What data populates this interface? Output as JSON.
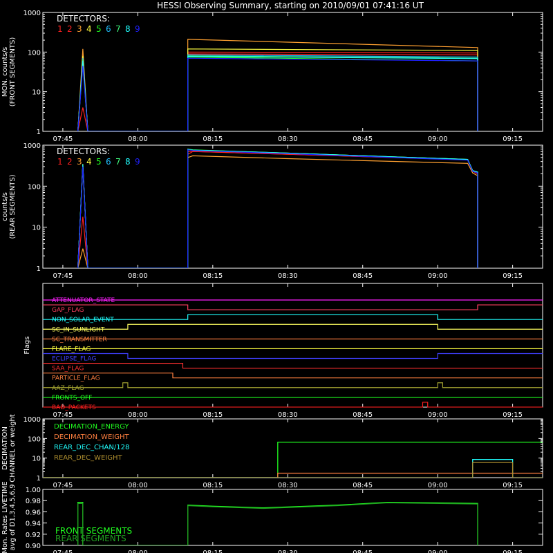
{
  "title": "HESSI Observing Summary, starting on 2010/09/01 07:41:16 UT",
  "time_ticks": [
    "07:45",
    "08:00",
    "08:15",
    "08:30",
    "08:45",
    "09:00",
    "09:15"
  ],
  "time_tick_hours": [
    7.75,
    8.0,
    8.25,
    8.5,
    8.75,
    9.0,
    9.25
  ],
  "colors": {
    "det": [
      "#ff2020",
      "#ff2020",
      "#ffa030",
      "#ffff40",
      "#20ff20",
      "#20c0ff",
      "#40ff80",
      "#20ffff",
      "#2020ff"
    ],
    "front_segments": "#20ff20",
    "rear_segments": "#20a020"
  },
  "chart_data": [
    {
      "id": "front",
      "type": "line",
      "ylabel": [
        "MON. counts/s",
        "(FRONT SEGMENTS)"
      ],
      "y_scale": "log",
      "ylim": [
        1,
        1000
      ],
      "y_ticks": [
        "1",
        "10",
        "100",
        "1000"
      ],
      "xlim": [
        "07:41",
        "09:21"
      ],
      "legend_title": "DETECTORS:",
      "legend": [
        "1",
        "2",
        "3",
        "4",
        "5",
        "6",
        "7",
        "8",
        "9"
      ],
      "series": [
        {
          "name": "1",
          "x": [
            "07:48",
            "07:49",
            "07:50",
            "08:10",
            "08:10",
            "09:08",
            "09:08"
          ],
          "y": [
            1,
            4,
            1,
            1,
            100,
            95,
            1
          ]
        },
        {
          "name": "2",
          "x": [
            "07:48",
            "07:49",
            "07:50",
            "08:10",
            "08:10",
            "09:08",
            "09:08"
          ],
          "y": [
            1,
            60,
            1,
            1,
            90,
            85,
            1
          ]
        },
        {
          "name": "3",
          "x": [
            "07:48",
            "07:49",
            "07:50",
            "08:10",
            "08:10",
            "09:08",
            "09:08"
          ],
          "y": [
            1,
            120,
            1,
            1,
            210,
            130,
            1
          ]
        },
        {
          "name": "4",
          "x": [
            "07:48",
            "07:49",
            "07:50",
            "08:10",
            "08:10",
            "09:08",
            "09:08"
          ],
          "y": [
            1,
            80,
            1,
            1,
            120,
            110,
            1
          ]
        },
        {
          "name": "5",
          "x": [
            "07:48",
            "07:49",
            "07:50",
            "08:10",
            "08:10",
            "09:08",
            "09:08"
          ],
          "y": [
            1,
            50,
            1,
            1,
            75,
            60,
            1
          ]
        },
        {
          "name": "6",
          "x": [
            "07:48",
            "07:49",
            "07:50",
            "08:10",
            "08:10",
            "09:08",
            "09:08"
          ],
          "y": [
            1,
            70,
            1,
            1,
            85,
            75,
            1
          ]
        },
        {
          "name": "7",
          "x": [
            "07:48",
            "07:49",
            "07:50",
            "08:10",
            "08:10",
            "09:08",
            "09:08"
          ],
          "y": [
            1,
            65,
            1,
            1,
            80,
            70,
            1
          ]
        },
        {
          "name": "8",
          "x": [
            "07:48",
            "07:49",
            "07:50",
            "08:10",
            "08:10",
            "09:08",
            "09:08"
          ],
          "y": [
            1,
            60,
            1,
            1,
            78,
            68,
            1
          ]
        },
        {
          "name": "9",
          "x": [
            "07:48",
            "07:49",
            "07:50",
            "08:10",
            "08:10",
            "09:08",
            "09:08"
          ],
          "y": [
            1,
            45,
            1,
            1,
            70,
            60,
            1
          ]
        }
      ]
    },
    {
      "id": "rear",
      "type": "line",
      "ylabel": [
        "counts/s",
        "(REAR SEGMENTS)"
      ],
      "y_scale": "log",
      "ylim": [
        1,
        1000
      ],
      "y_ticks": [
        "1",
        "10",
        "100",
        "1000"
      ],
      "xlim": [
        "07:41",
        "09:21"
      ],
      "legend_title": "DETECTORS:",
      "legend": [
        "1",
        "2",
        "3",
        "4",
        "5",
        "6",
        "7",
        "8",
        "9"
      ],
      "series": [
        {
          "name": "1",
          "x": [
            "07:48",
            "07:49",
            "07:50",
            "08:10",
            "08:10",
            "08:11",
            "08:30",
            "09:06",
            "09:07",
            "09:08",
            "09:08"
          ],
          "y": [
            1,
            18,
            1,
            1,
            600,
            700,
            600,
            440,
            230,
            210,
            1
          ]
        },
        {
          "name": "2",
          "x": [
            "07:48",
            "07:49",
            "07:50",
            "08:10",
            "08:10",
            "08:11",
            "08:30",
            "09:06",
            "09:07",
            "09:08",
            "09:08"
          ],
          "y": [
            1,
            300,
            1,
            1,
            700,
            700,
            600,
            440,
            230,
            200,
            1
          ]
        },
        {
          "name": "3",
          "x": [
            "07:48",
            "07:49",
            "07:50",
            "08:10",
            "08:10",
            "08:11",
            "08:30",
            "09:06",
            "09:07",
            "09:08",
            "09:08"
          ],
          "y": [
            1,
            3,
            1,
            1,
            500,
            550,
            470,
            360,
            210,
            180,
            1
          ]
        },
        {
          "name": "4",
          "x": [
            "07:48",
            "07:49",
            "07:50",
            "08:10",
            "08:10",
            "08:11",
            "08:30",
            "09:06",
            "09:07",
            "09:08",
            "09:08"
          ],
          "y": [
            1,
            350,
            1,
            1,
            800,
            760,
            640,
            450,
            240,
            220,
            1
          ]
        },
        {
          "name": "5",
          "x": [
            "07:48",
            "07:49",
            "07:50",
            "08:10",
            "08:10",
            "08:11",
            "08:30",
            "09:06",
            "09:07",
            "09:08",
            "09:08"
          ],
          "y": [
            1,
            330,
            1,
            1,
            800,
            770,
            640,
            450,
            240,
            220,
            1
          ]
        },
        {
          "name": "6",
          "x": [
            "07:48",
            "07:49",
            "07:50",
            "08:10",
            "08:10",
            "08:11",
            "08:30",
            "09:06",
            "09:07",
            "09:08",
            "09:08"
          ],
          "y": [
            1,
            320,
            1,
            1,
            780,
            750,
            630,
            440,
            235,
            215,
            1
          ]
        },
        {
          "name": "7",
          "x": [
            "07:48",
            "07:49",
            "07:50",
            "08:10",
            "08:10",
            "08:11",
            "08:30",
            "09:06",
            "09:07",
            "09:08",
            "09:08"
          ],
          "y": [
            1,
            330,
            1,
            1,
            780,
            750,
            630,
            440,
            235,
            215,
            1
          ]
        },
        {
          "name": "8",
          "x": [
            "07:48",
            "07:49",
            "07:50",
            "08:10",
            "08:10",
            "08:11",
            "08:30",
            "09:06",
            "09:07",
            "09:08",
            "09:08"
          ],
          "y": [
            1,
            340,
            1,
            1,
            790,
            760,
            640,
            450,
            240,
            220,
            1
          ]
        },
        {
          "name": "9",
          "x": [
            "07:48",
            "07:49",
            "07:50",
            "08:10",
            "08:10",
            "08:11",
            "08:30",
            "09:06",
            "09:07",
            "09:08",
            "09:08"
          ],
          "y": [
            1,
            300,
            1,
            1,
            770,
            740,
            620,
            430,
            230,
            210,
            1
          ]
        }
      ]
    },
    {
      "id": "flags",
      "type": "line",
      "ylabel": [
        "Flags"
      ],
      "xlim": [
        "07:41",
        "09:21"
      ],
      "flags": [
        {
          "name": "ATTENUATOR_STATE",
          "color": "#ff20ff",
          "x": [
            "07:41",
            "09:21"
          ],
          "state": [
            0,
            0
          ]
        },
        {
          "name": "GAP_FLAG",
          "color": "#ff4060",
          "x": [
            "07:41",
            "08:10",
            "09:08",
            "09:21"
          ],
          "state": [
            1,
            0,
            1,
            1
          ]
        },
        {
          "name": "NON_SOLAR_EVENT",
          "color": "#20ffff",
          "x": [
            "07:41",
            "08:10",
            "09:00",
            "09:21"
          ],
          "state": [
            0,
            1,
            0,
            0
          ]
        },
        {
          "name": "SC_IN_SUNLIGHT",
          "color": "#ffff60",
          "x": [
            "07:41",
            "07:58",
            "09:00",
            "09:21"
          ],
          "state": [
            0,
            1,
            0,
            0
          ]
        },
        {
          "name": "SC_TRANSMITTER",
          "color": "#ff8040",
          "x": [
            "07:41",
            "09:21"
          ],
          "state": [
            0,
            0
          ]
        },
        {
          "name": "FLARE_FLAG",
          "color": "#ffff40",
          "x": [
            "07:41",
            "09:21"
          ],
          "state": [
            0,
            0
          ]
        },
        {
          "name": "ECLIPSE_FLAG",
          "color": "#4040ff",
          "x": [
            "07:41",
            "07:58",
            "09:00",
            "09:21"
          ],
          "state": [
            1,
            0,
            1,
            1
          ]
        },
        {
          "name": "SAA_FLAG",
          "color": "#ff3030",
          "x": [
            "07:41",
            "08:09",
            "09:21"
          ],
          "state": [
            1,
            0,
            0
          ]
        },
        {
          "name": "PARTICLE_FLAG",
          "color": "#ff8040",
          "x": [
            "07:41",
            "08:07",
            "09:21"
          ],
          "state": [
            1,
            0,
            0
          ]
        },
        {
          "name": "AAZ_FLAG",
          "color": "#a0a030",
          "x": [
            "07:41",
            "07:57",
            "07:58",
            "09:00",
            "09:01",
            "09:21"
          ],
          "state": [
            0,
            1,
            0,
            1,
            0,
            0
          ]
        },
        {
          "name": "FRONTS_OFF",
          "color": "#20ff20",
          "x": [
            "07:41",
            "09:21"
          ],
          "state": [
            0,
            0
          ]
        },
        {
          "name": "BAD_PACKETS",
          "color": "#ff2020",
          "x": [
            "07:41",
            "08:57",
            "08:58",
            "09:21"
          ],
          "state": [
            0,
            1,
            0,
            0
          ]
        }
      ]
    },
    {
      "id": "decimation",
      "type": "line",
      "ylabel": [
        "DECIMATION",
        "CHANNEL or weight"
      ],
      "y_scale": "log",
      "ylim": [
        1,
        1000
      ],
      "y_ticks": [
        "1",
        "10",
        "100",
        "1000"
      ],
      "xlim": [
        "07:41",
        "09:21"
      ],
      "series": [
        {
          "name": "DECIMATION_ENERGY",
          "color": "#20ff20",
          "x": [
            "07:41",
            "08:28",
            "08:28",
            "09:21"
          ],
          "y": [
            1,
            1,
            65,
            65
          ]
        },
        {
          "name": "DECIMATION_WEIGHT",
          "color": "#ff8040",
          "x": [
            "07:41",
            "08:28",
            "08:28",
            "09:21"
          ],
          "y": [
            1,
            1,
            1.7,
            1.7
          ]
        },
        {
          "name": "REAR_DEC_CHAN/128",
          "color": "#20ffff",
          "x": [
            "07:41",
            "09:07",
            "09:07",
            "09:15",
            "09:15",
            "09:21"
          ],
          "y": [
            1,
            1,
            8.5,
            8.5,
            1,
            1
          ]
        },
        {
          "name": "REAR_DEC_WEIGHT",
          "color": "#b09030",
          "x": [
            "07:41",
            "09:07",
            "09:07",
            "09:15",
            "09:15",
            "09:21"
          ],
          "y": [
            1,
            1,
            6,
            6,
            1,
            1
          ]
        }
      ]
    },
    {
      "id": "livetime",
      "type": "line",
      "ylabel": [
        "Mon. Rates LIVETIME",
        "avg of D1,3,4,5,6,9"
      ],
      "ylim": [
        0.9,
        1.0
      ],
      "y_ticks": [
        "0.90",
        "0.92",
        "0.94",
        "0.96",
        "0.98",
        "1.00"
      ],
      "xlim": [
        "07:41",
        "09:21"
      ],
      "series": [
        {
          "name": "FRONT SEGMENTS",
          "color": "#20ff20",
          "x": [
            "07:48",
            "07:48",
            "07:49",
            "07:49",
            "08:10",
            "08:10",
            "08:15",
            "08:25",
            "08:40",
            "08:50",
            "09:08",
            "09:08"
          ],
          "y": [
            0.9,
            0.977,
            0.977,
            0.9,
            0.9,
            0.972,
            0.97,
            0.967,
            0.972,
            0.977,
            0.975,
            0.9
          ]
        },
        {
          "name": "REAR SEGMENTS",
          "color": "#20a020",
          "x": [
            "07:48",
            "07:48",
            "07:49",
            "07:49",
            "08:10",
            "08:10",
            "08:15",
            "08:25",
            "08:40",
            "08:50",
            "09:08",
            "09:08"
          ],
          "y": [
            0.9,
            0.975,
            0.975,
            0.9,
            0.9,
            0.971,
            0.969,
            0.966,
            0.971,
            0.976,
            0.974,
            0.9
          ]
        }
      ]
    }
  ]
}
